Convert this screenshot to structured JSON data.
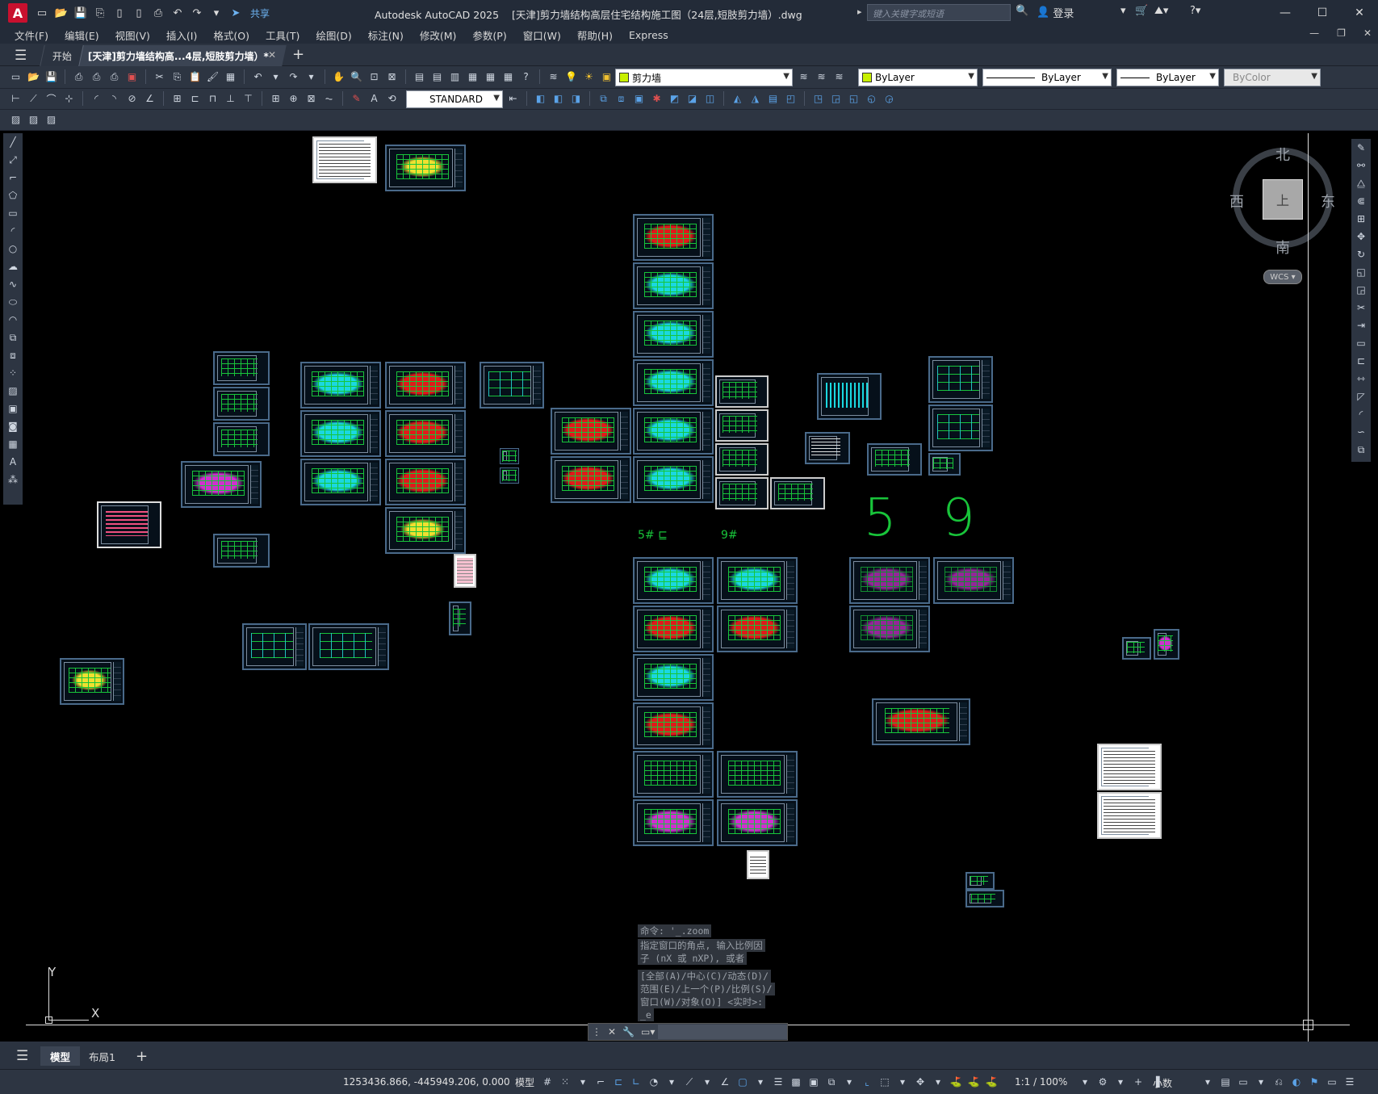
{
  "app": {
    "logo": "A",
    "title": "Autodesk AutoCAD 2025",
    "document_title": "[天津]剪力墙结构高层住宅结构施工图（24层,短肢剪力墙）.dwg",
    "share_label": "共享",
    "search_placeholder": "键入关键字或短语",
    "login_label": "登录"
  },
  "menu": [
    "文件(F)",
    "编辑(E)",
    "视图(V)",
    "插入(I)",
    "格式(O)",
    "工具(T)",
    "绘图(D)",
    "标注(N)",
    "修改(M)",
    "参数(P)",
    "窗口(W)",
    "帮助(H)",
    "Express"
  ],
  "tabs": {
    "start": "开始",
    "doc": "[天津]剪力墙结构高...4层,短肢剪力墙）*"
  },
  "toolbar": {
    "layer": "剪力墙",
    "layer_color": "#c8f000",
    "color": "ByLayer",
    "color_swatch": "#c8f000",
    "linetype": "ByLayer",
    "lineweight": "ByLayer",
    "plotstyle": "ByColor",
    "textstyle": "STANDARD"
  },
  "viewcube": {
    "north": "北",
    "south": "南",
    "east": "东",
    "west": "西",
    "face": "上",
    "wcs": "WCS"
  },
  "drawing_labels": {
    "big_five": "5",
    "big_nine": "9",
    "label_5": "5# ⊑",
    "label_9": "9#"
  },
  "ucs": {
    "y": "Y",
    "x": "X"
  },
  "command": {
    "history": [
      "命令: '_.zoom",
      "指定窗口的角点, 输入比例因",
      "子 (nX 或 nXP), 或者",
      "[全部(A)/中心(C)/动态(D)/",
      "范围(E)/上一个(P)/比例(S)/",
      "窗口(W)/对象(O)] <实时>:",
      "_e"
    ],
    "input_placeholder": ""
  },
  "layouts": {
    "model": "模型",
    "layout1": "布局1"
  },
  "status": {
    "coords": "1253436.866, -445949.206, 0.000",
    "model": "模型",
    "scale": "1:1 / 100%",
    "units": "小数"
  }
}
